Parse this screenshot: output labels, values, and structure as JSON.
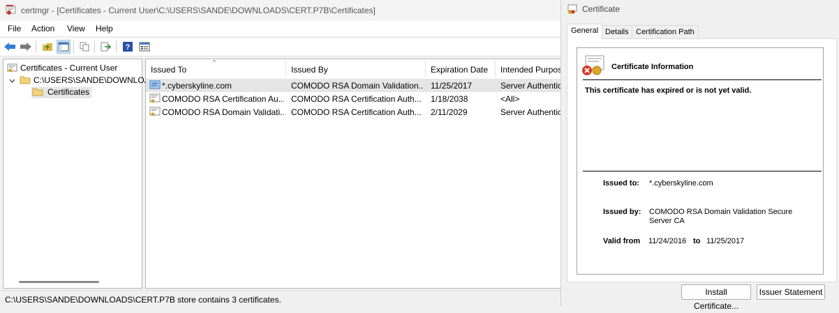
{
  "main_window": {
    "title": "certmgr - [Certificates - Current User\\C:\\USERS\\SANDE\\DOWNLOADS\\CERT.P7B\\Certificates]",
    "menu": [
      "File",
      "Action",
      "View",
      "Help"
    ],
    "tree": {
      "root": "Certificates - Current User",
      "store": "C:\\USERS\\SANDE\\DOWNLOA",
      "folder": "Certificates"
    },
    "columns": [
      "Issued To",
      "Issued By",
      "Expiration Date",
      "Intended Purpos"
    ],
    "rows": [
      {
        "issued_to": "*.cyberskyline.com",
        "issued_by": "COMODO RSA Domain Validation...",
        "expiration": "11/25/2017",
        "purpose": "Server Authenticati"
      },
      {
        "issued_to": "COMODO RSA Certification Au...",
        "issued_by": "COMODO RSA Certification Auth...",
        "expiration": "1/18/2038",
        "purpose": "<All>"
      },
      {
        "issued_to": "COMODO RSA Domain Validati...",
        "issued_by": "COMODO RSA Certification Auth...",
        "expiration": "2/11/2029",
        "purpose": "Server Authenticati"
      }
    ],
    "status": "C:\\USERS\\SANDE\\DOWNLOADS\\CERT.P7B store contains 3 certificates."
  },
  "dialog": {
    "title": "Certificate",
    "tabs": [
      "General",
      "Details",
      "Certification Path"
    ],
    "heading": "Certificate Information",
    "warning": "This certificate has expired or is not yet valid.",
    "issued_to_label": "Issued to:",
    "issued_to": "*.cyberskyline.com",
    "issued_by_label": "Issued by:",
    "issued_by": "COMODO RSA Domain Validation Secure Server CA",
    "valid_from_label": "Valid from",
    "valid_from": "11/24/2016",
    "to_label": "to",
    "valid_to": "11/25/2017",
    "install_button": "Install Certificate...",
    "issuer_button": "Issuer Statement"
  },
  "colors": {
    "selection": "#e5e5e5",
    "folder": "#f3d27a",
    "back_arrow": "#2f7fd6"
  }
}
